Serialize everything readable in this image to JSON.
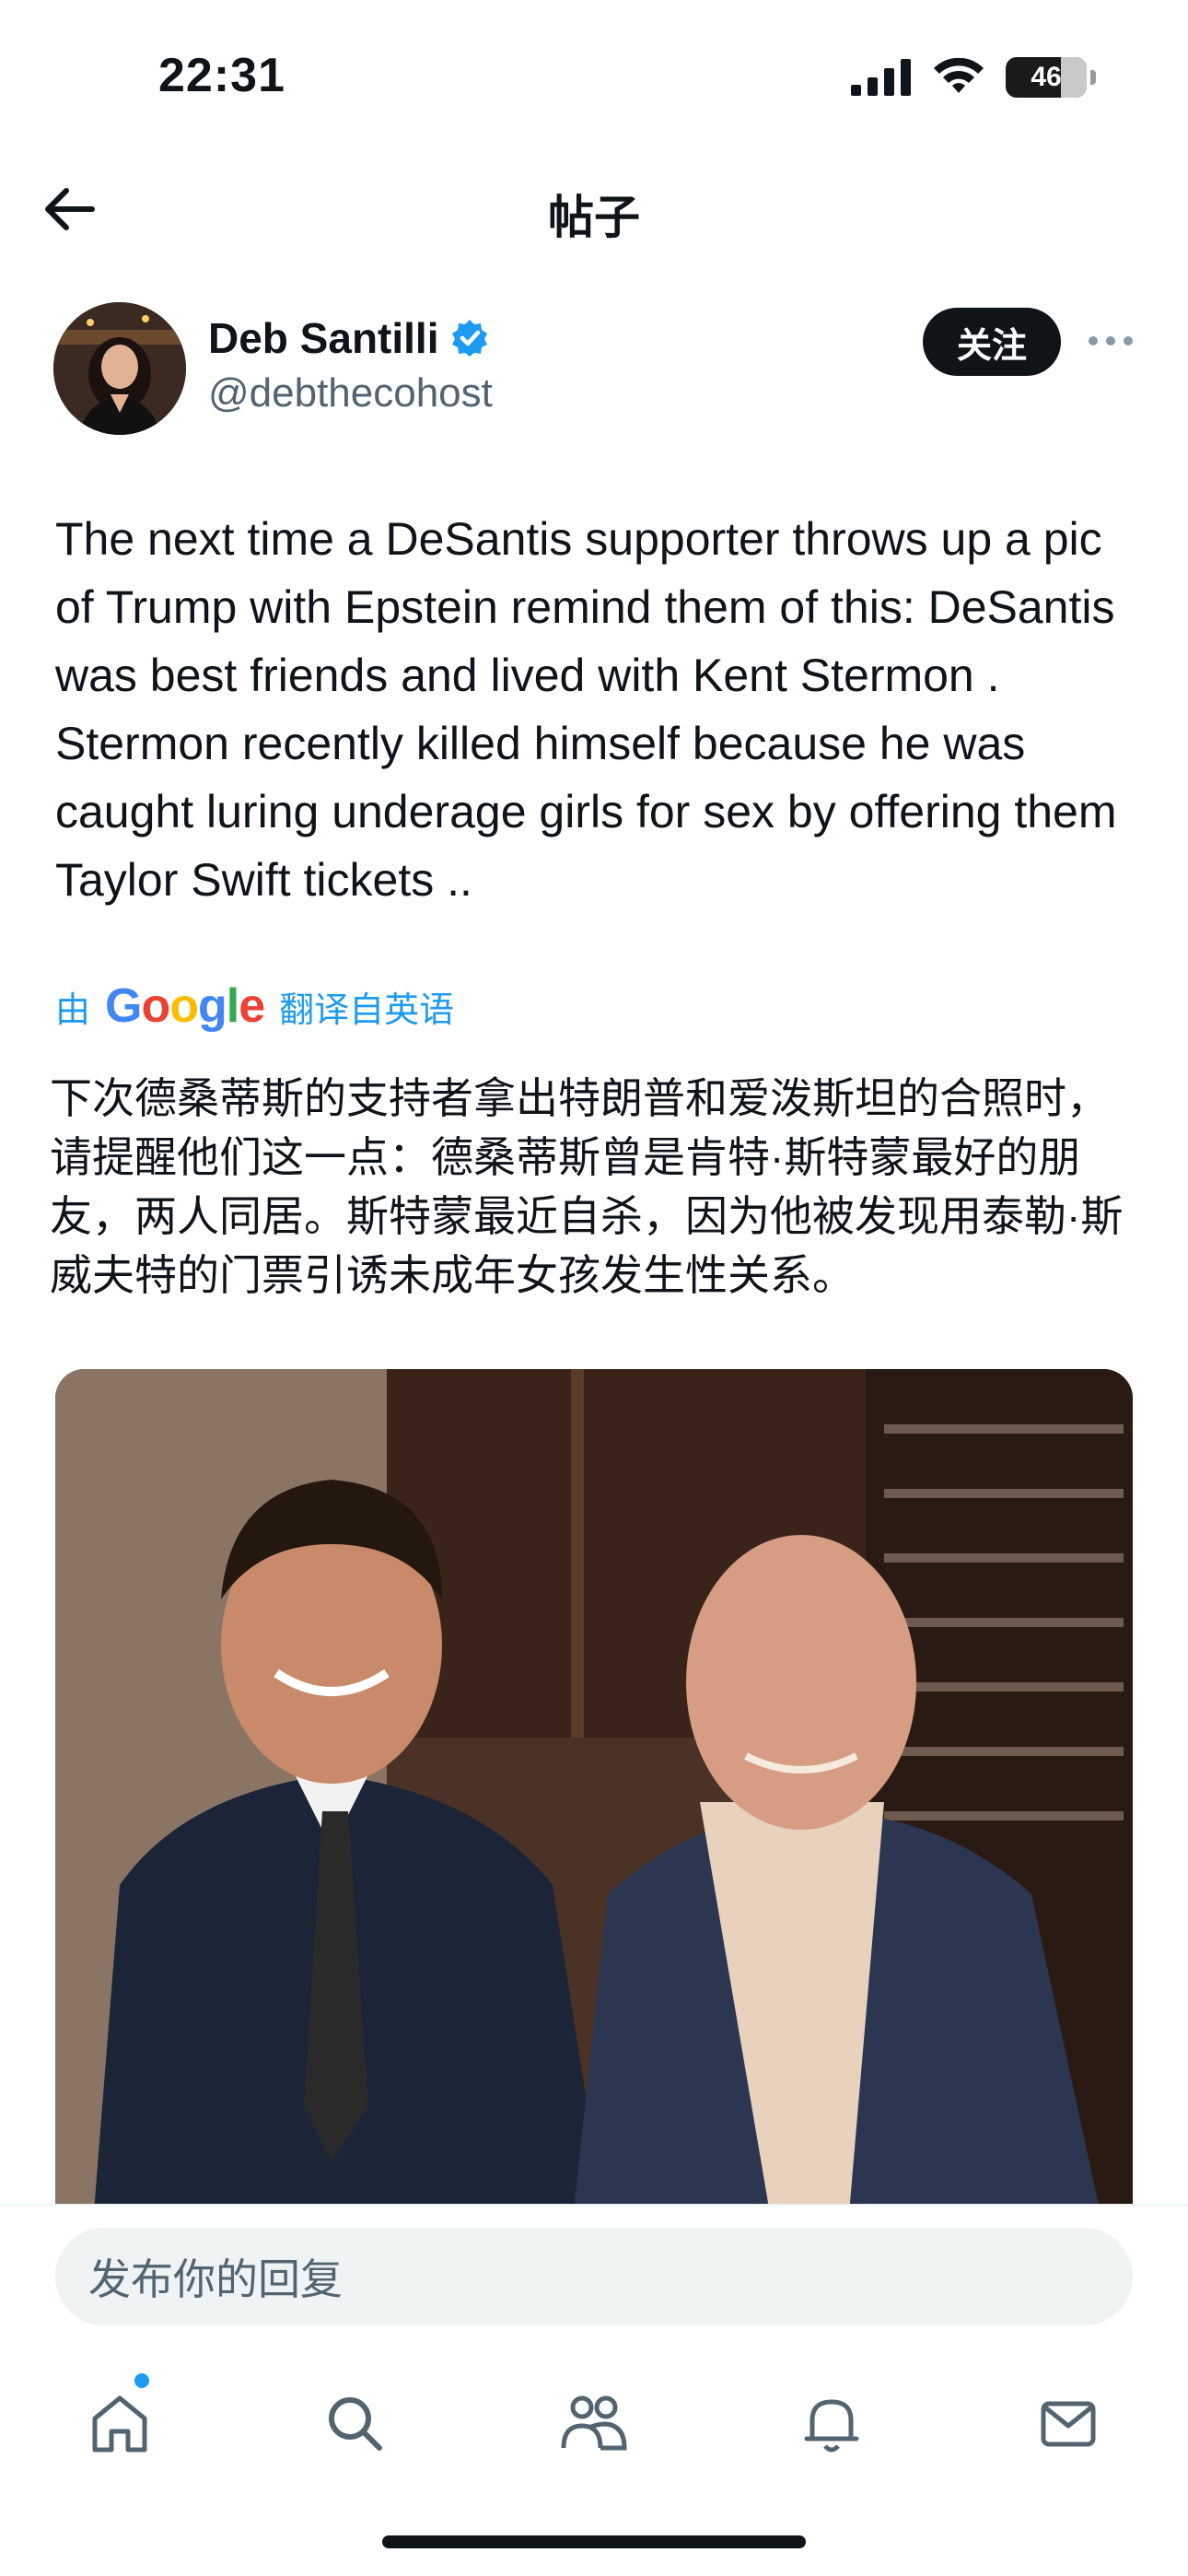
{
  "status_bar": {
    "time": "22:31",
    "battery": "46"
  },
  "header": {
    "title": "帖子"
  },
  "author": {
    "name": "Deb Santilli",
    "handle": "@debthecohost",
    "follow_label": "关注"
  },
  "tweet": {
    "text": "The next time a DeSantis supporter throws up a pic of Trump with Epstein remind them of this: DeSantis was best friends and lived with Kent Stermon . Stermon recently killed himself because he was caught luring underage girls for sex by offering them Taylor Swift tickets ..",
    "translation_prefix": "由",
    "translation_brand": "Google",
    "translation_suffix": "翻译自英语",
    "translated_text": "下次德桑蒂斯的支持者拿出特朗普和爱泼斯坦的合照时，请提醒他们这一点：德桑蒂斯曾是肯特·斯特蒙最好的朋友，两人同居。斯特蒙最近自杀，因为他被发现用泰勒·斯威夫特的门票引诱未成年女孩发生性关系。"
  },
  "reply": {
    "placeholder": "发布你的回复"
  },
  "colors": {
    "accent": "#1d9bf0",
    "text": "#0f1419",
    "muted": "#536471"
  },
  "tab_bar": {
    "items": [
      "home-icon",
      "search-icon",
      "communities-icon",
      "notifications-icon",
      "messages-icon"
    ]
  }
}
